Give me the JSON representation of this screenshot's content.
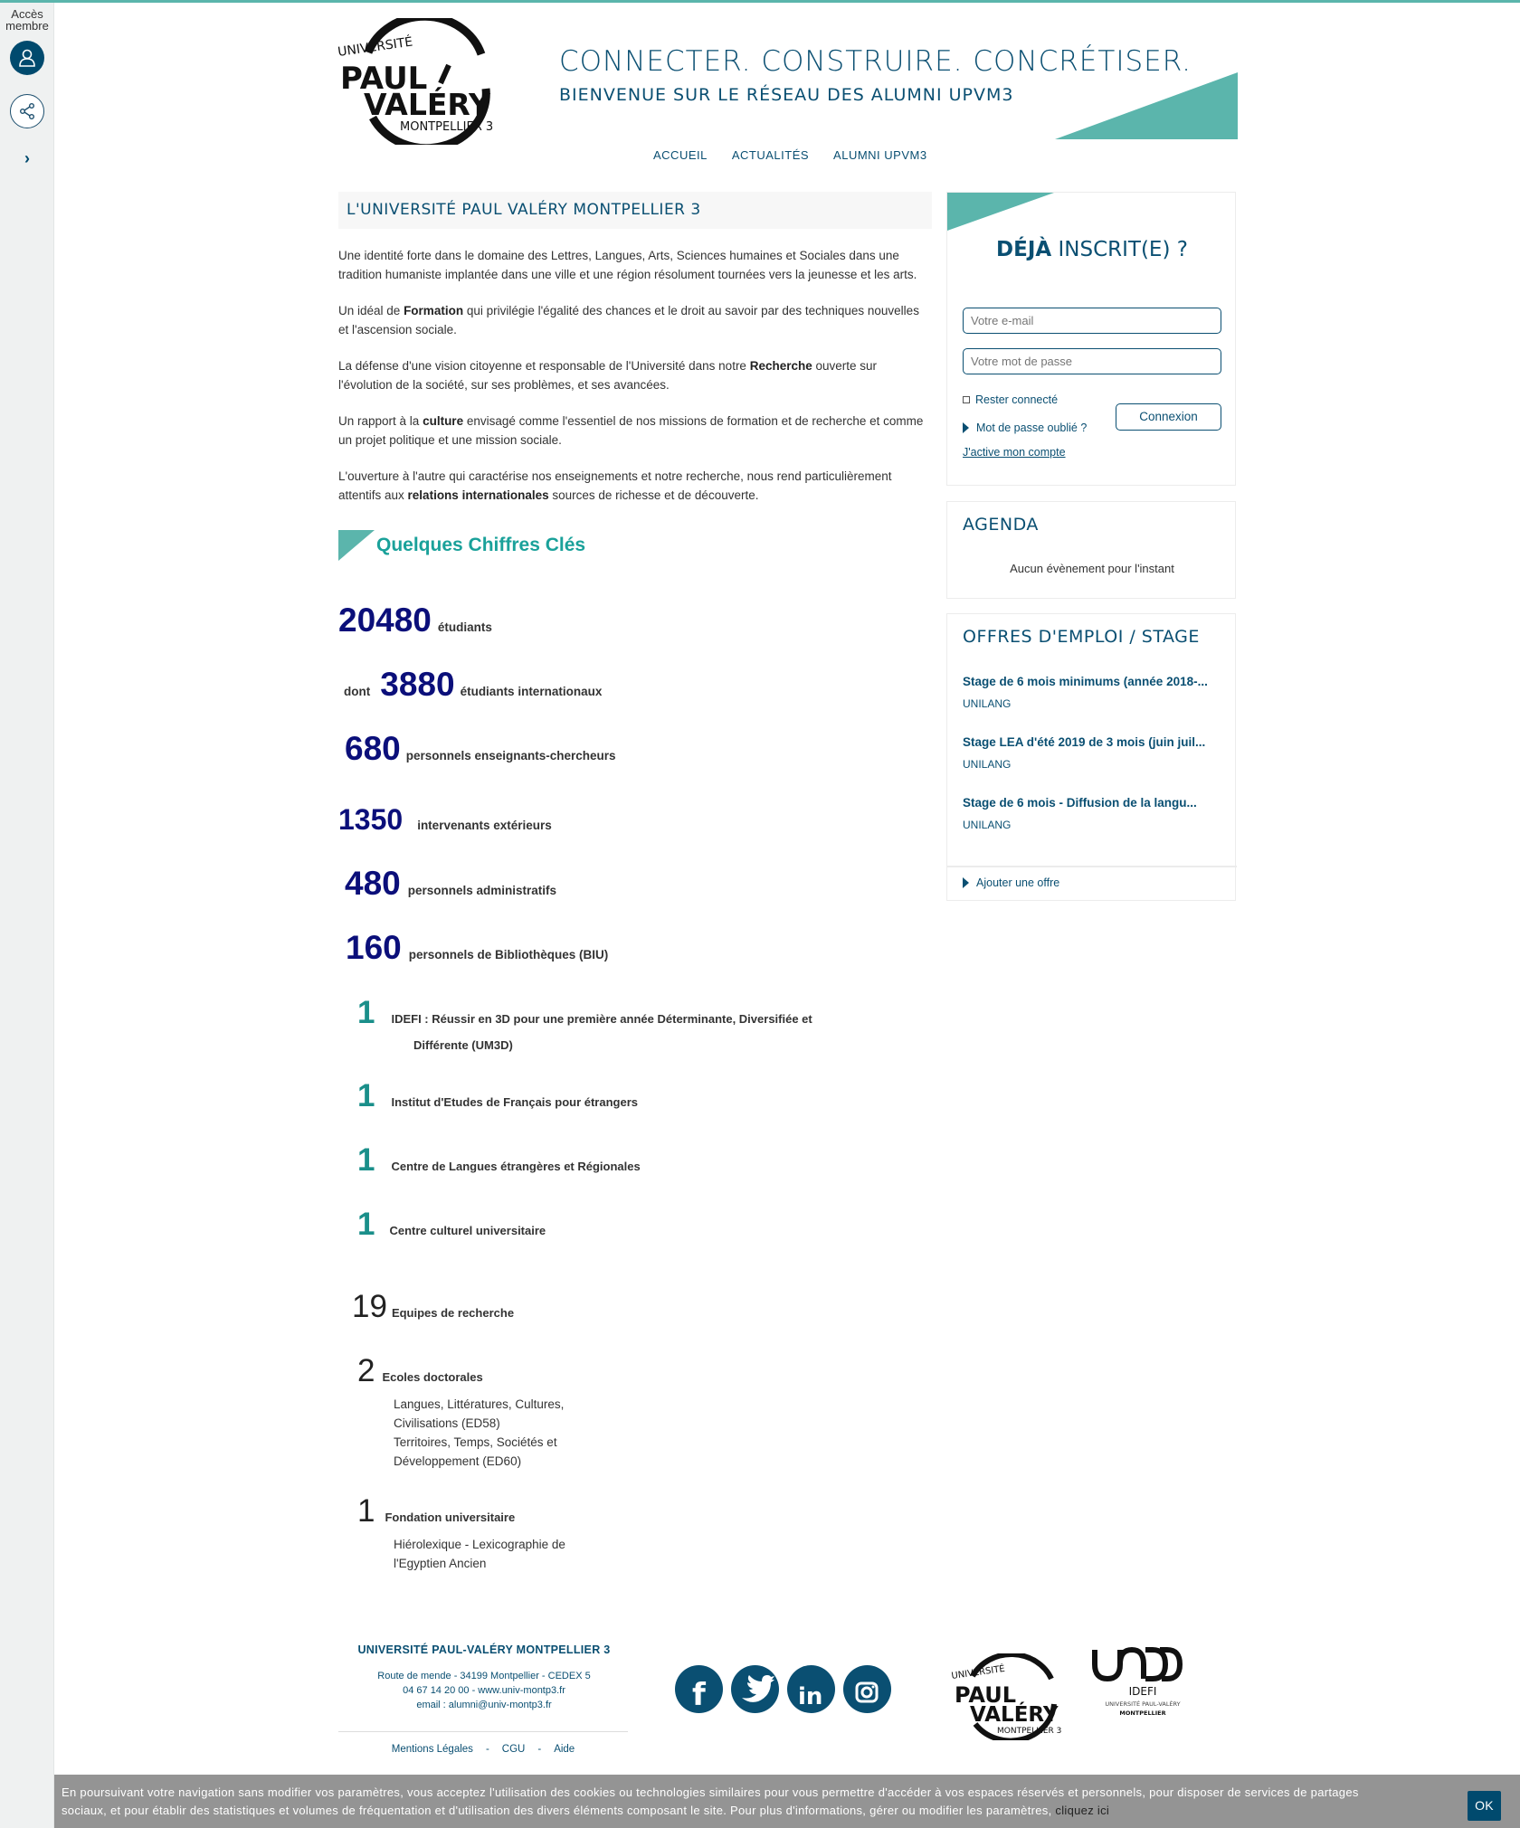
{
  "rail": {
    "label_line1": "Accès",
    "label_line2": "membre",
    "expand": "›"
  },
  "header": {
    "logo": {
      "line1": "UNIVERSITÉ",
      "line2": "PAUL",
      "line3": "VALÉRY",
      "line4": "MONTPELLIER 3"
    },
    "slogan": "CONNECTER. CONSTRUIRE. CONCRÉTISER.",
    "subslogan": "BIENVENUE SUR LE RÉSEAU DES ALUMNI UPVM3",
    "accent_color": "#5bb5ac",
    "brand_color": "#0a4f72"
  },
  "nav": [
    {
      "label": "ACCUEIL"
    },
    {
      "label": "ACTUALITÉS"
    },
    {
      "label": "ALUMNI UPVM3"
    }
  ],
  "main": {
    "title": "L'UNIVERSITÉ PAUL VALÉRY MONTPELLIER 3",
    "p1": "Une identité forte dans le domaine des Lettres, Langues, Arts, Sciences humaines et Sociales dans une tradition humaniste implantée dans une ville et une région résolument tournées vers la jeunesse et les arts.",
    "p2a": "Un idéal de ",
    "p2b": "Formation",
    "p2c": " qui privilégie l'égalité des chances et le droit au savoir par des techniques nouvelles et l'ascension sociale.",
    "p3a": "La défense d'une vision citoyenne et responsable de l'Université dans notre ",
    "p3b": "Recherche",
    "p3c": " ouverte sur l'évolution de la société, sur ses problèmes, et ses avancées.",
    "p4a": "Un rapport à la ",
    "p4b": "culture",
    "p4c": " envisagé comme l'essentiel de nos missions de formation et de recherche et comme un projet politique et une mission sociale.",
    "p5a": "L'ouverture à l'autre qui caractérise nos enseignements et notre recherche, nous rend particulièrement attentifs aux ",
    "p5b": "relations internationales",
    "p5c": " sources de richesse et de découverte.",
    "keyfigures_title": "Quelques Chiffres Clés"
  },
  "stats": {
    "s1": {
      "num": "20480",
      "label": "étudiants"
    },
    "s2": {
      "pre": "dont",
      "num": "3880",
      "label": "étudiants internationaux"
    },
    "s3": {
      "num": "680",
      "label": "personnels enseignants-chercheurs"
    },
    "s4": {
      "num": "1350",
      "label": "intervenants extérieurs"
    },
    "s5": {
      "num": "480",
      "label": "personnels  administratifs"
    },
    "s6": {
      "num": "160",
      "label": "personnels de Bibliothèques (BIU)"
    },
    "s7": {
      "num": "1",
      "label": "IDEFI : Réussir en 3D pour une première année Déterminante, Diversifiée et",
      "label2": "Différente (UM3D)"
    },
    "s8": {
      "num": "1",
      "label": "Institut d'Etudes de Français pour étrangers"
    },
    "s9": {
      "num": "1",
      "label": "Centre de Langues étrangères et Régionales"
    },
    "s10": {
      "num": "1",
      "label": "Centre culturel universitaire"
    },
    "s11": {
      "num": "19",
      "label": "Equipes de recherche"
    },
    "s12": {
      "num": "2",
      "label": "Ecoles doctorales",
      "sub1": "Langues, Littératures, Cultures,",
      "sub2": "Civilisations (ED58)",
      "sub3": "Territoires, Temps, Sociétés et",
      "sub4": "Développement (ED60)"
    },
    "s13": {
      "num": "1",
      "label": "Fondation universitaire",
      "sub1": "Hiérolexique  - Lexicographie de",
      "sub2": "l'Egyptien Ancien"
    }
  },
  "login": {
    "title_bold": "DÉJÀ",
    "title_rest": " INSCRIT(E) ?",
    "email_placeholder": "Votre e-mail",
    "password_placeholder": "Votre mot de passe",
    "remember": "Rester connecté",
    "forgot": "Mot de passe oublié ?",
    "activate": "J'active mon compte",
    "submit": "Connexion"
  },
  "agenda": {
    "title": "AGENDA",
    "empty": "Aucun évènement pour l'instant"
  },
  "jobs": {
    "title": "OFFRES D'EMPLOI / STAGE",
    "items": [
      {
        "title": "Stage de 6 mois minimums (année 2018-...",
        "company": "UNILANG"
      },
      {
        "title": "Stage LEA d'été 2019 de 3 mois (juin juil...",
        "company": "UNILANG"
      },
      {
        "title": "Stage de 6 mois - Diffusion de la langu...",
        "company": "UNILANG"
      }
    ],
    "add": "Ajouter une offre"
  },
  "footer": {
    "uni": "UNIVERSITÉ PAUL-VALÉRY MONTPELLIER 3",
    "addr1": "Route de mende - 34199 Montpellier - CEDEX 5",
    "addr2": "04 67 14 20 00 - www.univ-montp3.fr",
    "addr3": "email : alumni@univ-montp3.fr",
    "links": {
      "legal": "Mentions Légales",
      "cgu": "CGU",
      "help": "Aide",
      "dash": "-"
    },
    "social_icons": [
      "facebook-icon",
      "twitter-icon",
      "linkedin-icon",
      "instagram-icon"
    ],
    "idefi": {
      "name": "IDEFI",
      "sub1": "UNIVERSITÉ PAUL-VALÉRY",
      "sub2": "MONTPELLIER"
    }
  },
  "cookie": {
    "text": "En poursuivant votre navigation sans modifier vos paramètres, vous acceptez l'utilisation des cookies ou technologies similaires pour vous permettre d'accéder à vos espaces réservés et personnels, pour disposer de services de partages sociaux, et pour établir des statistiques et volumes de fréquentation et d'utilisation des divers éléments composant le site. Pour plus d'informations, gérer ou modifier les paramètres,",
    "link": "cliquez ici",
    "ok": "OK"
  }
}
